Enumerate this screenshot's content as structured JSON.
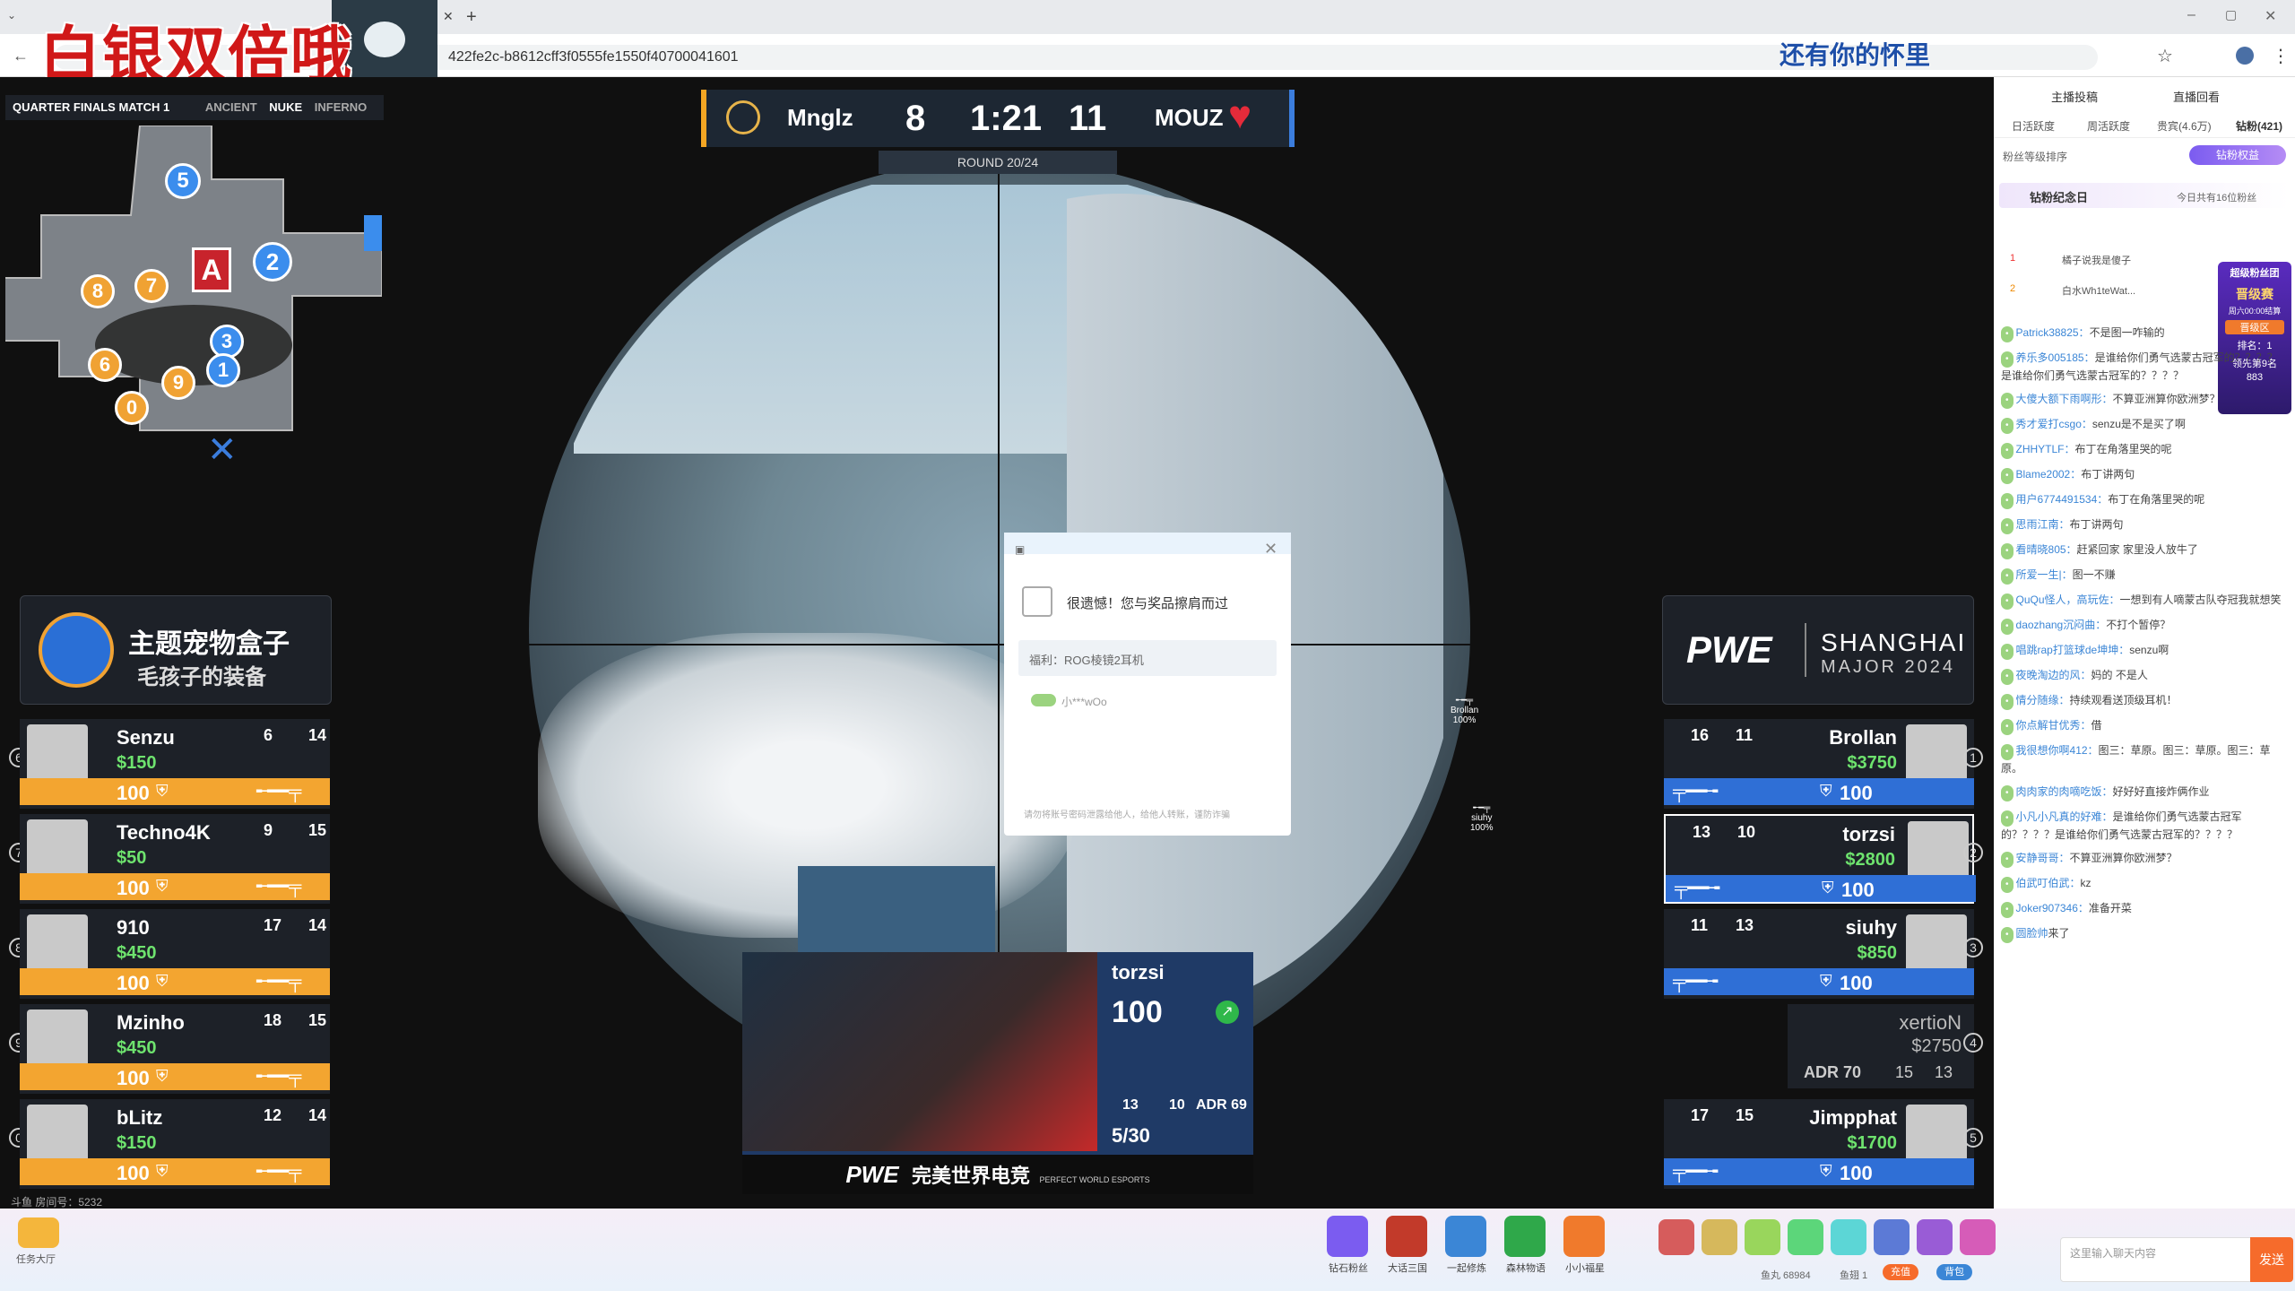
{
  "browser": {
    "url": "422fe2c-b8612cff3f0555fe1550f40700041601",
    "overlay_left": "白银双倍哦",
    "overlay_right": "还有你的怀里"
  },
  "map": {
    "title": "QUARTER FINALS MATCH 1",
    "maps": [
      "ANCIENT",
      "NUKE",
      "INFERNO"
    ],
    "site": "A",
    "markers": [
      "5",
      "2",
      "8",
      "7",
      "3",
      "1",
      "6",
      "9",
      "0"
    ]
  },
  "scoreboard": {
    "team_left": "Mnglz",
    "score_left": "8",
    "time": "1:21",
    "score_right": "11",
    "team_right": "MOUZ",
    "round": "ROUND 20/24"
  },
  "ad_left": {
    "line1": "主题宠物盒子",
    "line2": "毛孩子的装备"
  },
  "ad_right": {
    "brand": "PWE",
    "event": "SHANGHAI",
    "year": "MAJOR 2024"
  },
  "left_players": [
    {
      "slot": "6",
      "name": "Senzu",
      "money": "$150",
      "kills": "6",
      "deaths": "14",
      "hp": "100"
    },
    {
      "slot": "7",
      "name": "Techno4K",
      "money": "$50",
      "kills": "9",
      "deaths": "15",
      "hp": "100"
    },
    {
      "slot": "8",
      "name": "910",
      "money": "$450",
      "kills": "17",
      "deaths": "14",
      "hp": "100"
    },
    {
      "slot": "9",
      "name": "Mzinho",
      "money": "$450",
      "kills": "18",
      "deaths": "15",
      "hp": "100"
    },
    {
      "slot": "0",
      "name": "bLitz",
      "money": "$150",
      "kills": "12",
      "deaths": "14",
      "hp": "100"
    }
  ],
  "right_players": [
    {
      "slot": "1",
      "name": "Brollan",
      "money": "$3750",
      "kills": "16",
      "deaths": "11",
      "hp": "100"
    },
    {
      "slot": "2",
      "name": "torzsi",
      "money": "$2800",
      "kills": "13",
      "deaths": "10",
      "hp": "100"
    },
    {
      "slot": "3",
      "name": "siuhy",
      "money": "$850",
      "kills": "11",
      "deaths": "13",
      "hp": "100"
    },
    {
      "slot": "5",
      "name": "Jimpphat",
      "money": "$1700",
      "kills": "17",
      "deaths": "15",
      "hp": "100"
    }
  ],
  "dead_player": {
    "slot": "4",
    "name": "xertioN",
    "money": "$2750",
    "adr": "ADR 70",
    "kills": "15",
    "deaths": "13"
  },
  "spectating": {
    "name": "torzsi",
    "hp": "100",
    "kills": "13",
    "deaths": "10",
    "adr": "ADR 69",
    "kd": "5/30",
    "brand": "完美世界电竞",
    "brand_sub": "PERFECT WORLD ESPORTS"
  },
  "world_labels": [
    {
      "name": "Brollan",
      "hp": "100%"
    },
    {
      "name": "siuhy",
      "hp": "100%"
    }
  ],
  "modal": {
    "message": "很遗憾！您与奖品擦肩而过",
    "prize": "福利：ROG棱镜2耳机",
    "winner": "小***wOo",
    "footer": "请勿将账号密码泄露给他人，给他人转账，谨防诈骗"
  },
  "status": {
    "room": "斗鱼 房间号：5232",
    "task": "任务大厅"
  },
  "chat": {
    "tabs_top": [
      "主播投稿",
      "直播回看"
    ],
    "tabs": [
      "日活跃度",
      "周活跃度",
      "贵宾(4.6万)",
      "钻粉(421)"
    ],
    "sort_label": "粉丝等级排序",
    "fan_badge": "钻粉权益",
    "fan_day": "钻粉纪念日",
    "fan_day_note": "今日共有16位粉丝",
    "top_fans": [
      {
        "rank": "1",
        "name": "橘子说我是傻子"
      },
      {
        "rank": "2",
        "name": "白水Wh1teWat..."
      }
    ],
    "promo": {
      "title": "超级粉丝团",
      "sub": "晋级赛",
      "time": "周六00:00结算",
      "zone": "晋级区",
      "rank": "排名：1",
      "lead": "领先第9名",
      "num": "883"
    },
    "messages": [
      {
        "user": "Patrick38825：",
        "text": "不是图一咋输的"
      },
      {
        "user": "养乐多005185：",
        "text": "是谁给你们勇气选蒙古冠军的？？？？是谁给你们勇气选蒙古冠军的？？？？"
      },
      {
        "user": "大傻大额下雨啊形：",
        "text": "不算亚洲算你欧洲梦？"
      },
      {
        "user": "秀才爱打csgo：",
        "text": "senzu是不是买了啊"
      },
      {
        "user": "ZHHYTLF：",
        "text": "布丁在角落里哭的呢"
      },
      {
        "user": "Blame2002：",
        "text": "布丁讲两句"
      },
      {
        "user": "用户6774491534：",
        "text": "布丁在角落里哭的呢"
      },
      {
        "user": "思雨江南：",
        "text": "布丁讲两句"
      },
      {
        "user": "看晴晓805：",
        "text": "赶紧回家 家里没人放牛了"
      },
      {
        "user": "所爱一生|：",
        "text": "图一不赚"
      },
      {
        "user": "QuQu怪人，高玩佐：",
        "text": "一想到有人嘀蒙古队夺冠我就想笑"
      },
      {
        "user": "daozhang沉闷曲：",
        "text": "不打个暂停？"
      },
      {
        "user": "唱跳rap打篮球de坤坤：",
        "text": "senzu啊"
      },
      {
        "user": "夜晚淘边的风：",
        "text": "妈的 不是人"
      },
      {
        "user": "情分随缘：",
        "text": "持续观看送顶级耳机！"
      },
      {
        "user": "你点解甘优秀：",
        "text": "借"
      },
      {
        "user": "我很想你啊412：",
        "text": "图三：草原。图三：草原。图三：草原。"
      },
      {
        "user": "肉肉家的肉嘀吃饭：",
        "text": "好好好直接炸俩作业"
      },
      {
        "user": "小凡小凡真的好难：",
        "text": "是谁给你们勇气选蒙古冠军的？？？？是谁给你们勇气选蒙古冠军的？？？？"
      },
      {
        "user": "安静哥哥：",
        "text": "不算亚洲算你欧洲梦？"
      },
      {
        "user": "伯武叮伯武：",
        "text": "kz"
      },
      {
        "user": "Joker907346：",
        "text": "准备开菜"
      },
      {
        "user": "圆脸帅",
        "text": "来了"
      }
    ],
    "input_placeholder": "这里输入聊天内容",
    "send": "发送",
    "fish_count": "鱼丸 68984",
    "fish_bone": "鱼翅 1",
    "recharge": "充值",
    "bag": "背包",
    "gift_bar": [
      "钻石粉丝",
      "大话三国",
      "一起修炼",
      "森林物语",
      "小小福星"
    ]
  },
  "colors": {
    "left_team": "#f3a530",
    "right_team": "#2f6fd6",
    "money": "#6ee36e"
  }
}
